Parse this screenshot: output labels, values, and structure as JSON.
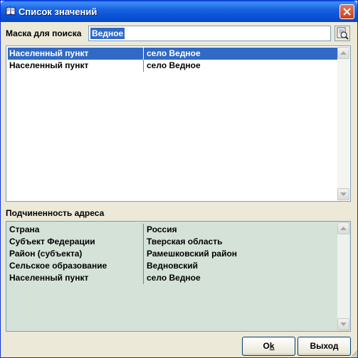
{
  "window": {
    "title": "Список значений"
  },
  "search": {
    "label": "Маска для поиска",
    "value": "Ведное"
  },
  "results": {
    "rows": [
      {
        "type": "Населенный пункт",
        "value": "село Ведное",
        "selected": true
      },
      {
        "type": "Населенный пункт",
        "value": "село Ведное",
        "selected": false
      }
    ]
  },
  "hierarchy": {
    "label": "Подчиненность адреса",
    "rows": [
      {
        "type": "Страна",
        "value": "Россия"
      },
      {
        "type": "Субъект Федерации",
        "value": "Тверская область"
      },
      {
        "type": "Район (субъекта)",
        "value": "Рамешковский район"
      },
      {
        "type": "Сельское образование",
        "value": "Ведновский"
      },
      {
        "type": "Населенный пункт",
        "value": "село Ведное"
      }
    ]
  },
  "buttons": {
    "ok_label": "Ok",
    "exit_label": "Выход"
  },
  "icons": {
    "title": "book-icon",
    "close": "close-icon",
    "search": "find-icon"
  },
  "colors": {
    "titlebar": "#0a54d4",
    "selection": "#316ac5",
    "hierarchy_bg": "#d4e2d8",
    "dialog_bg": "#ece9d8"
  }
}
